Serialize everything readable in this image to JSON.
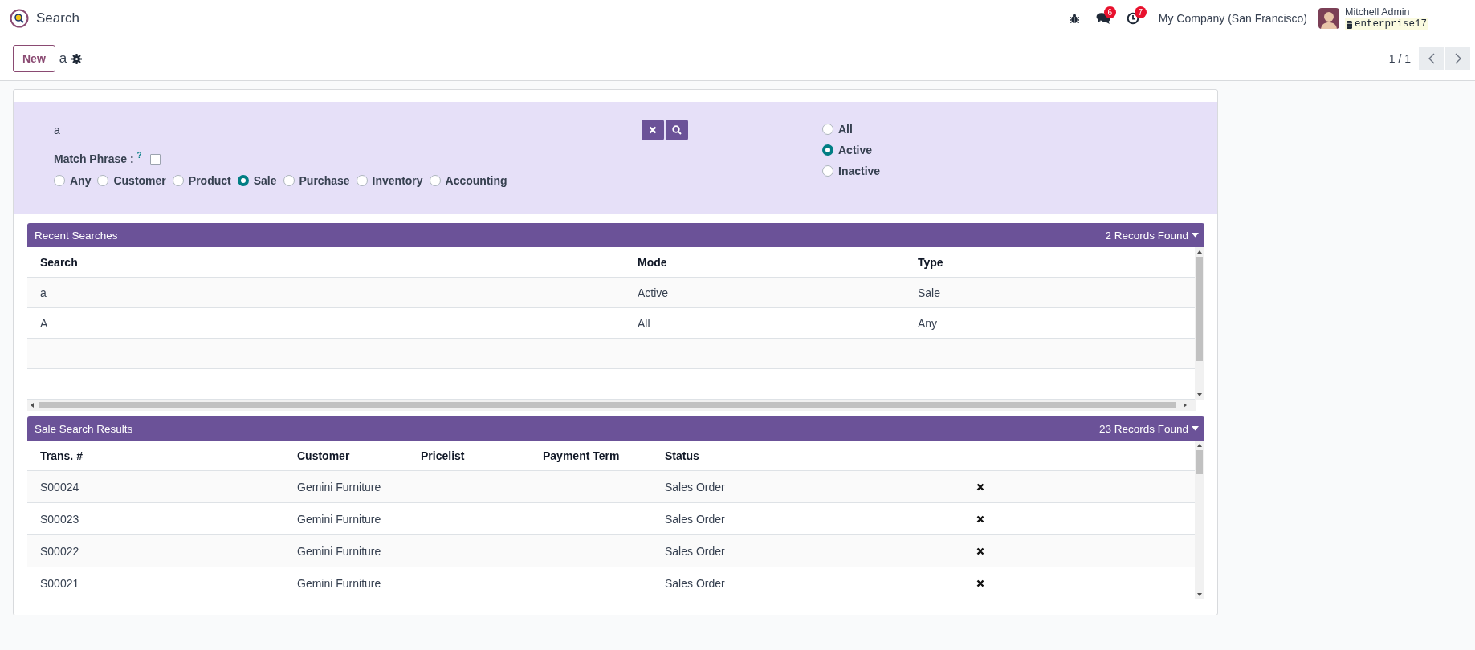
{
  "app": {
    "title": "Search"
  },
  "systray": {
    "message_count": "6",
    "activity_count": "7",
    "company": "My Company (San Francisco)",
    "user_name": "Mitchell Admin",
    "database": "enterprise17"
  },
  "control_panel": {
    "new_button": "New",
    "breadcrumb": "a",
    "pager": "1 / 1"
  },
  "search_form": {
    "query": "a",
    "match_phrase_label": "Match Phrase :",
    "help_mark": "?",
    "match_phrase_checked": false,
    "categories": [
      {
        "label": "Any",
        "selected": false
      },
      {
        "label": "Customer",
        "selected": false
      },
      {
        "label": "Product",
        "selected": false
      },
      {
        "label": "Sale",
        "selected": true
      },
      {
        "label": "Purchase",
        "selected": false
      },
      {
        "label": "Inventory",
        "selected": false
      },
      {
        "label": "Accounting",
        "selected": false
      }
    ],
    "status_options": [
      {
        "label": "All",
        "selected": false
      },
      {
        "label": "Active",
        "selected": true
      },
      {
        "label": "Inactive",
        "selected": false
      }
    ]
  },
  "recent_searches": {
    "title": "Recent Searches",
    "count": "2 Records Found",
    "columns": [
      "Search",
      "Mode",
      "Type"
    ],
    "rows": [
      {
        "search": "a",
        "mode": "Active",
        "type": "Sale"
      },
      {
        "search": "A",
        "mode": "All",
        "type": "Any"
      }
    ]
  },
  "results": {
    "title": "Sale Search Results",
    "count": "23 Records Found",
    "columns": [
      "Trans. #",
      "Customer",
      "Pricelist",
      "Payment Term",
      "Status"
    ],
    "rows": [
      {
        "trans": "S00024",
        "customer": "Gemini Furniture",
        "status": "Sales Order"
      },
      {
        "trans": "S00023",
        "customer": "Gemini Furniture",
        "status": "Sales Order"
      },
      {
        "trans": "S00022",
        "customer": "Gemini Furniture",
        "status": "Sales Order"
      },
      {
        "trans": "S00021",
        "customer": "Gemini Furniture",
        "status": "Sales Order"
      }
    ]
  }
}
